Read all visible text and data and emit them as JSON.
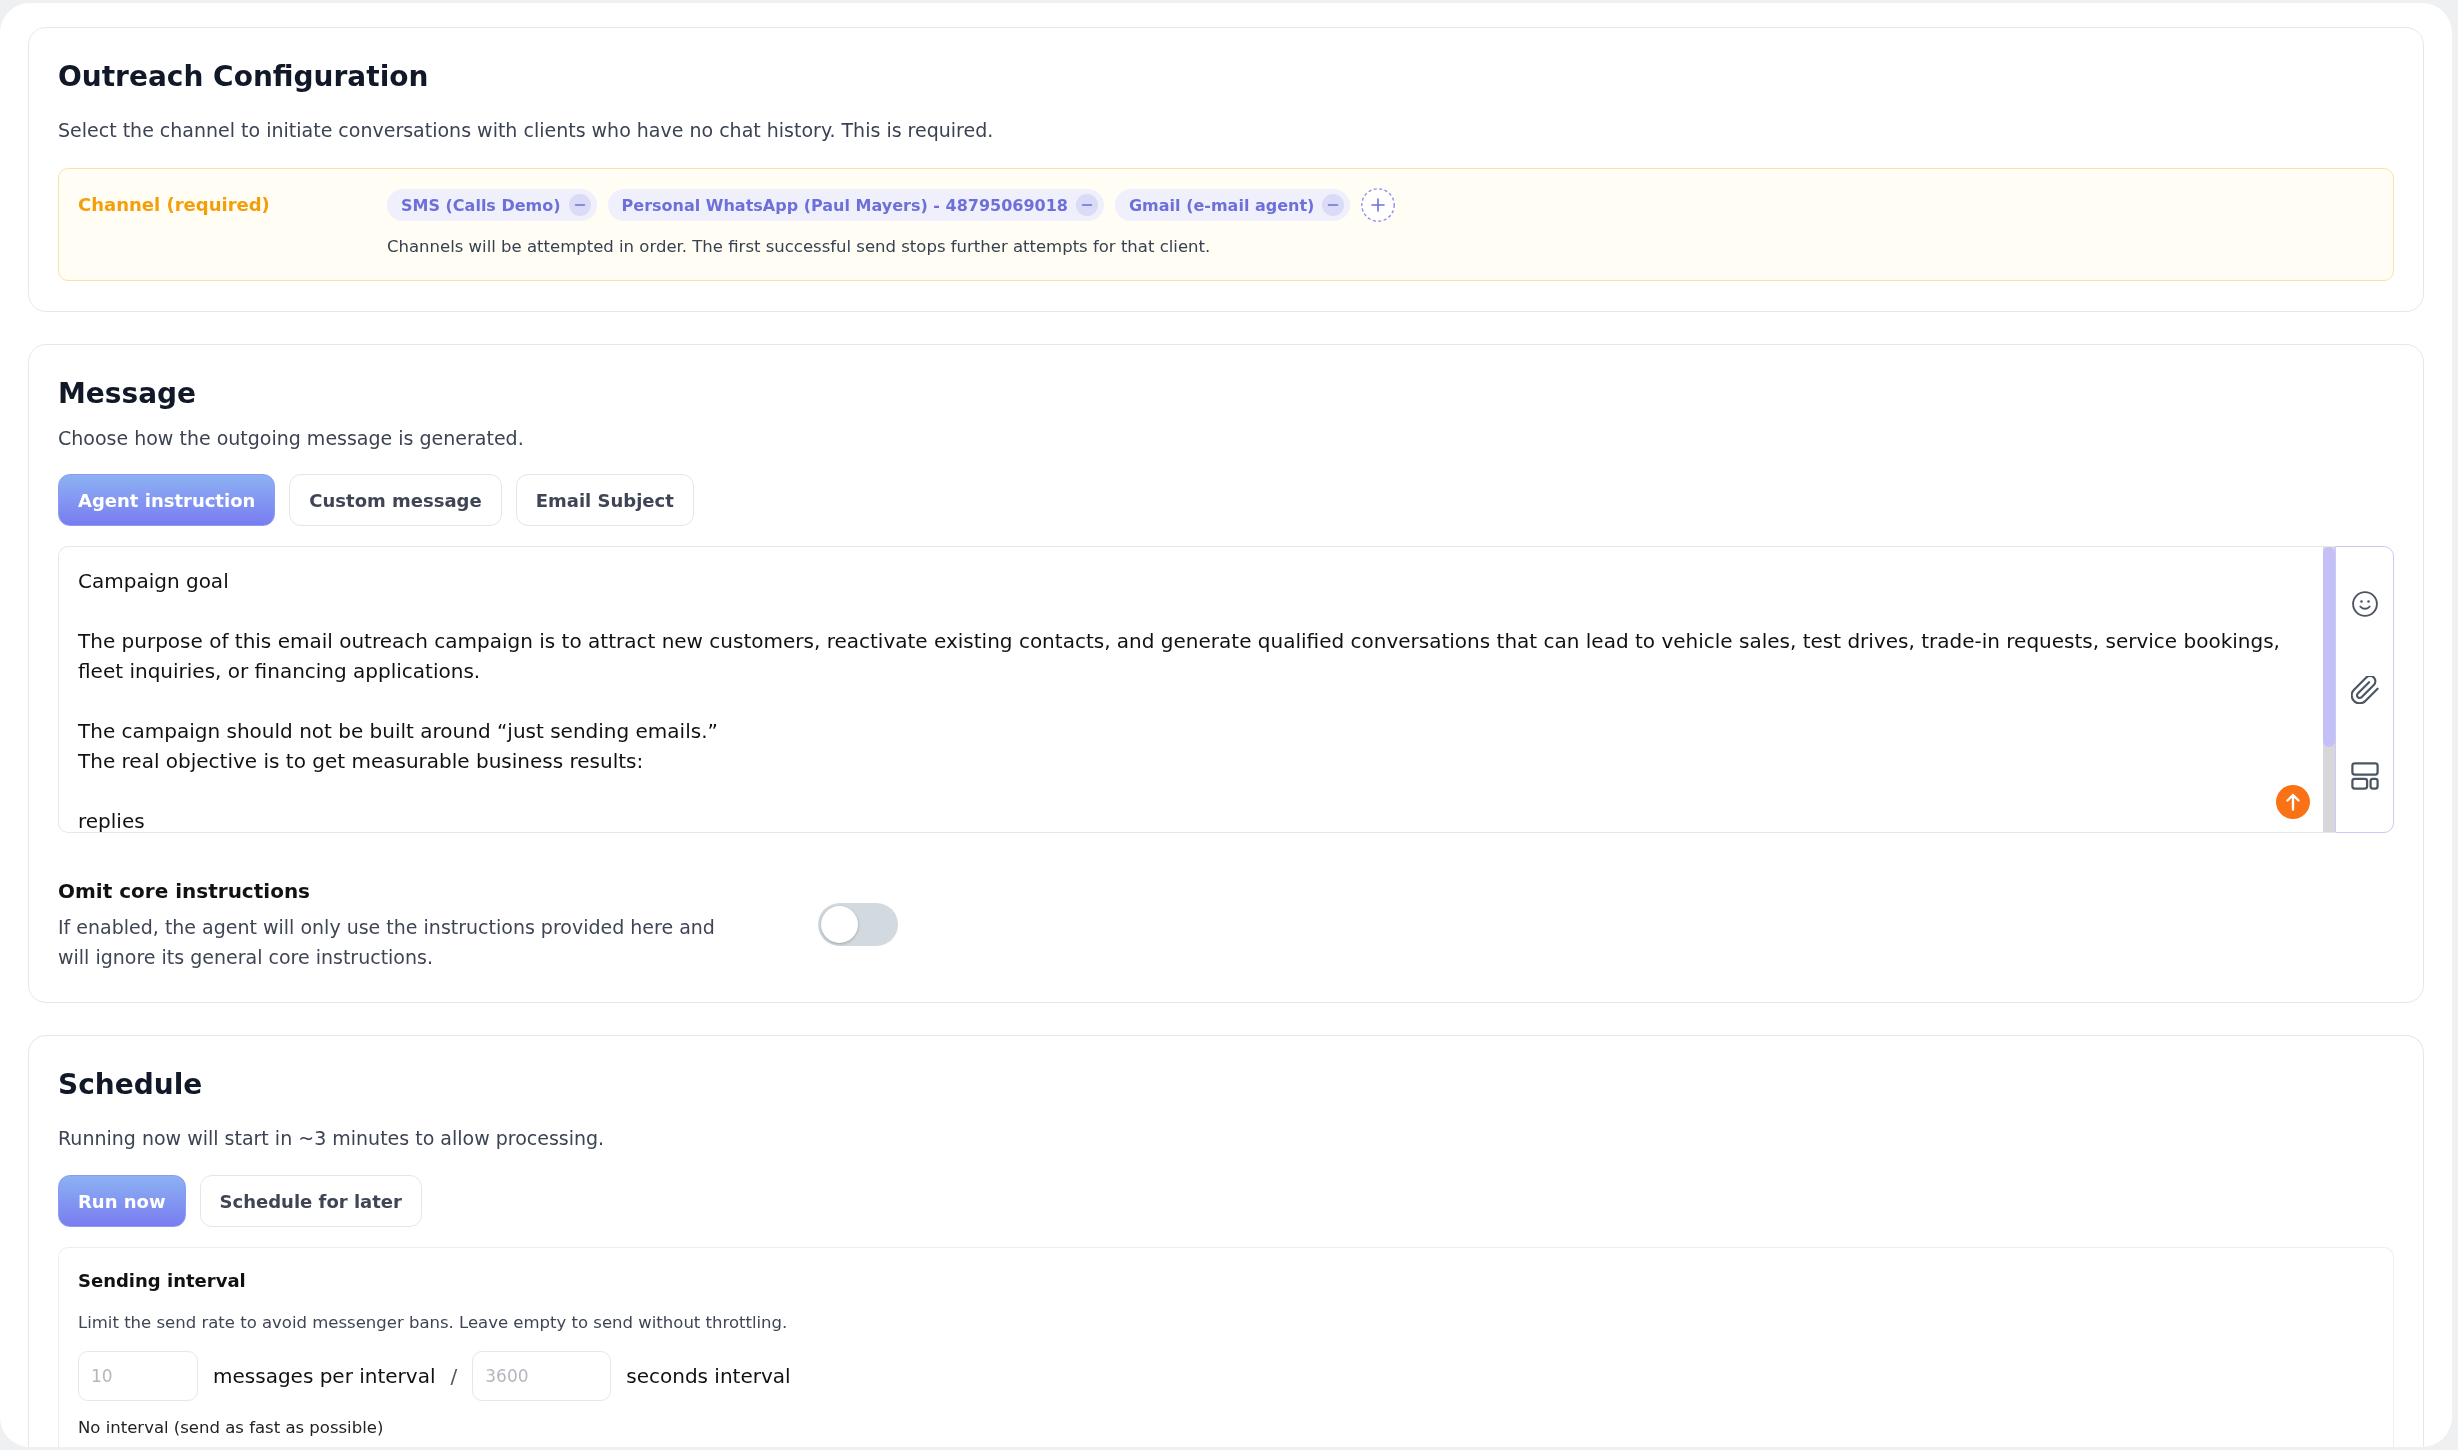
{
  "outreach": {
    "title": "Outreach Configuration",
    "description": "Select the channel to initiate conversations with clients who have no chat history. This is required.",
    "channel": {
      "label": "Channel (required)",
      "chips": [
        {
          "label": "SMS (Calls Demo)"
        },
        {
          "label": "Personal WhatsApp (Paul Mayers) - 48795069018"
        },
        {
          "label": "Gmail (e-mail agent)"
        }
      ],
      "helper": "Channels will be attempted in order. The first successful send stops further attempts for that client."
    }
  },
  "message": {
    "title": "Message",
    "description": "Choose how the outgoing message is generated.",
    "tabs": [
      {
        "label": "Agent instruction",
        "selected": true
      },
      {
        "label": "Custom message",
        "selected": false
      },
      {
        "label": "Email Subject",
        "selected": false
      }
    ],
    "instruction": {
      "value": "Campaign goal\n\nThe purpose of this email outreach campaign is to attract new customers, reactivate existing contacts, and generate qualified conversations that can lead to vehicle sales, test drives, trade-in requests, service bookings, fleet inquiries, or financing applications.\n\nThe campaign should not be built around “just sending emails.”\nThe real objective is to get measurable business results:\n\nreplies"
    },
    "omit_core": {
      "title": "Omit core instructions",
      "description": "If enabled, the agent will only use the instructions provided here and will ignore its general core instructions.",
      "on": false
    }
  },
  "schedule": {
    "title": "Schedule",
    "description": "Running now will start in ~3 minutes to allow processing.",
    "modes": [
      {
        "label": "Run now",
        "selected": true
      },
      {
        "label": "Schedule for later",
        "selected": false
      }
    ],
    "sending_interval": {
      "title": "Sending interval",
      "description": "Limit the send rate to avoid messenger bans. Leave empty to send without throttling.",
      "messages": {
        "placeholder": "10"
      },
      "messages_label": "messages per interval",
      "separator": "/",
      "seconds": {
        "placeholder": "3600"
      },
      "seconds_label": "seconds interval",
      "note": "No interval (send as fast as possible)"
    }
  }
}
